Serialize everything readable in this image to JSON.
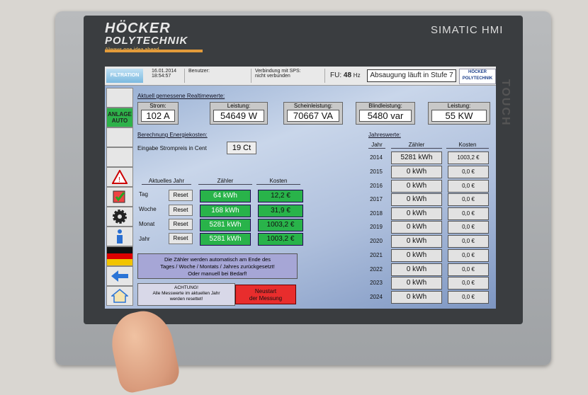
{
  "device": {
    "brand_line1": "HÖCKER",
    "brand_line2": "POLYTECHNIK",
    "tagline": "Always one idea ahead",
    "model": "SIMATIC HMI",
    "side_label": "TOUCH"
  },
  "topbar": {
    "filtration_label": "FILTRATION",
    "date": "16.01.2014",
    "time": "18:54:57",
    "user_label": "Benutzer:",
    "sps_label": "Verbindung mit SPS:",
    "sps_value": "nicht verbunden",
    "fu_label": "FU:",
    "fu_value": "48",
    "fu_unit": "Hz",
    "status_text": "Absaugung läuft in Stufe 7",
    "brand_small_1": "HÖCKER",
    "brand_small_2": "POLYTECHNIK"
  },
  "sidebar": {
    "anlage_line1": "ANLAGE",
    "anlage_line2": "AUTO"
  },
  "realtime": {
    "title": "Aktuell gemessene Realtimewerte:",
    "items": [
      {
        "label": "Strom:",
        "value": "102 A"
      },
      {
        "label": "Leistung:",
        "value": "54649 W"
      },
      {
        "label": "Scheinleistung:",
        "value": "70667 VA"
      },
      {
        "label": "Blindleistung:",
        "value": "5480 var"
      },
      {
        "label": "Leistung:",
        "value": "55 KW"
      }
    ]
  },
  "energy": {
    "title": "Berechnung Energiekosten:",
    "price_label": "Eingabe Strompreis in Cent",
    "price_value": "19 Ct",
    "col_year": "Aktuelles Jahr",
    "col_counter": "Zähler",
    "col_cost": "Kosten",
    "reset_label": "Reset",
    "rows": [
      {
        "label": "Tag",
        "counter": "64 kWh",
        "cost": "12,2 €"
      },
      {
        "label": "Woche",
        "counter": "168 kWh",
        "cost": "31,9 €"
      },
      {
        "label": "Monat",
        "counter": "5281 kWh",
        "cost": "1003,2 €"
      },
      {
        "label": "Jahr",
        "counter": "5281 kWh",
        "cost": "1003,2 €"
      }
    ],
    "info_line1": "Die Zähler werden automatisch am Ende des",
    "info_line2": "Tages / Woche / Montats / Jahres zurückgesetzt!",
    "info_line3": "Oder manuell bei Bedarf!",
    "warn_line1": "ACHTUNG!",
    "warn_line2": "Alle Messwerte im aktuellen Jahr",
    "warn_line3": "werden resettet!",
    "restart_line1": "Neustart",
    "restart_line2": "der Messung"
  },
  "annual": {
    "title": "Jahreswerte:",
    "col_year": "Jahr",
    "col_counter": "Zähler",
    "col_cost": "Kosten",
    "rows": [
      {
        "year": "2014",
        "counter": "5281 kWh",
        "cost": "1003,2 €"
      },
      {
        "year": "2015",
        "counter": "0 kWh",
        "cost": "0,0 €"
      },
      {
        "year": "2016",
        "counter": "0 kWh",
        "cost": "0,0 €"
      },
      {
        "year": "2017",
        "counter": "0 kWh",
        "cost": "0,0 €"
      },
      {
        "year": "2018",
        "counter": "0 kWh",
        "cost": "0,0 €"
      },
      {
        "year": "2019",
        "counter": "0 kWh",
        "cost": "0,0 €"
      },
      {
        "year": "2020",
        "counter": "0 kWh",
        "cost": "0,0 €"
      },
      {
        "year": "2021",
        "counter": "0 kWh",
        "cost": "0,0 €"
      },
      {
        "year": "2022",
        "counter": "0 kWh",
        "cost": "0,0 €"
      },
      {
        "year": "2023",
        "counter": "0 kWh",
        "cost": "0,0 €"
      },
      {
        "year": "2024",
        "counter": "0 kWh",
        "cost": "0,0 €"
      }
    ]
  },
  "colors": {
    "green": "#29b34a",
    "red": "#e82d2d",
    "accent": "#e39b3a"
  }
}
